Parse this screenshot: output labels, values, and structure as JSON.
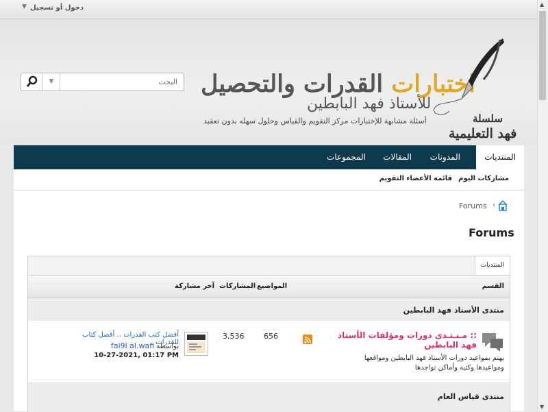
{
  "topbar": {
    "login_label": "دخول أو تسجيل",
    "arrow": "▼"
  },
  "header": {
    "title_accent": "اختبارات",
    "title_rest": " القدرات والتحصيل",
    "subtitle": "للأستاذ فهد البابطين",
    "tagline": "أسئلة مشابهة للإختبارات مركز التقويم والقياس وحلول سهله بدون تعقيد",
    "brand_line1": "سلسلة",
    "brand_line2": "فهد التعليمية"
  },
  "search": {
    "placeholder": "البحث",
    "drop_arrow": "▼"
  },
  "nav": {
    "items": [
      "المنتديات",
      "المدونات",
      "المقالات",
      "المجموعات"
    ],
    "subitems": [
      "مشاركات اليوم",
      "قائمة الأعضاء",
      "التقويم"
    ]
  },
  "breadcrumb": {
    "label": "Forums",
    "arrow": "‹"
  },
  "page_title": "Forums",
  "table": {
    "tab": "المنتديات",
    "headers": {
      "section": "القسم",
      "topics": "المواضيع",
      "posts": "المشاركات",
      "last_post": "آخر مشاركة"
    },
    "categories": [
      {
        "title": "منتدى الأستاذ فهد البابطين",
        "forums": [
          {
            "title": ":: مـنـتـدى دورات ومؤلفات الأستاذ فهد البابطين",
            "description": "يهتم بمواعيد دورات الأستاذ فهد البابطين ومواقعها ومواعيدها وكتبه وأماكن تواجدها",
            "topics": "656",
            "posts": "3,536",
            "last_title": "أفضل كتب القدرات .. أفضل كتاب للقدرات",
            "last_by_prefix": "بواسطة",
            "last_user": "fai9l al.wafi",
            "last_date": "10-27-2021, 01:17 PM"
          }
        ]
      },
      {
        "title": "منتدى قياس العام"
      }
    ]
  },
  "colors": {
    "nav_bg": "#0f3a4e",
    "accent": "#e5a823",
    "forum_title": "#d3336a",
    "link": "#2a62b0",
    "rss": "#ef8a18"
  }
}
